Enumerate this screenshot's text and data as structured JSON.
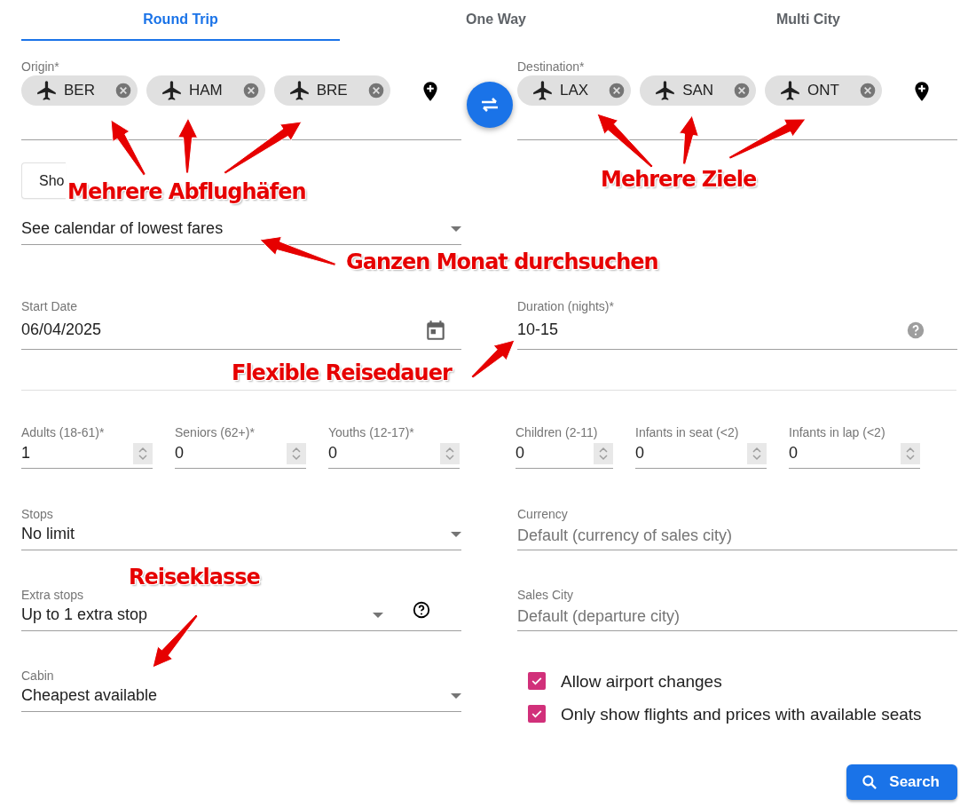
{
  "tabs": [
    {
      "label": "Round Trip",
      "selected": true
    },
    {
      "label": "One Way",
      "selected": false
    },
    {
      "label": "Multi City",
      "selected": false
    }
  ],
  "origin": {
    "label": "Origin*",
    "chips": [
      {
        "code": "BER"
      },
      {
        "code": "HAM"
      },
      {
        "code": "BRE"
      }
    ]
  },
  "destination": {
    "label": "Destination*",
    "chips": [
      {
        "code": "LAX"
      },
      {
        "code": "SAN"
      },
      {
        "code": "ONT"
      }
    ]
  },
  "advanced_button": {
    "label": "Sho"
  },
  "calendar_select": {
    "value": "See calendar of lowest fares"
  },
  "start_date": {
    "label": "Start Date",
    "value": "06/04/2025"
  },
  "duration": {
    "label": "Duration (nights)*",
    "value": "10-15"
  },
  "passengers": [
    {
      "label": "Adults (18-61)*",
      "value": "1"
    },
    {
      "label": "Seniors (62+)*",
      "value": "0"
    },
    {
      "label": "Youths (12-17)*",
      "value": "0"
    },
    {
      "label": "Children (2-11)",
      "value": "0"
    },
    {
      "label": "Infants in seat (<2)",
      "value": "0"
    },
    {
      "label": "Infants in lap (<2)",
      "value": "0"
    }
  ],
  "stops": {
    "label": "Stops",
    "value": "No limit"
  },
  "currency": {
    "label": "Currency",
    "placeholder": "Default (currency of sales city)"
  },
  "extra_stops": {
    "label": "Extra stops",
    "value": "Up to 1 extra stop"
  },
  "sales_city": {
    "label": "Sales City",
    "placeholder": "Default (departure city)"
  },
  "cabin": {
    "label": "Cabin",
    "value": "Cheapest available"
  },
  "checkboxes": [
    {
      "label": "Allow airport changes",
      "checked": true
    },
    {
      "label": "Only show flights and prices with available seats",
      "checked": true
    }
  ],
  "search_button": {
    "label": "Search"
  },
  "annotations": [
    {
      "text": "Mehrere Abflughäfen"
    },
    {
      "text": "Mehrere Ziele"
    },
    {
      "text": "Ganzen Monat durchsuchen"
    },
    {
      "text": "Flexible Reisedauer"
    },
    {
      "text": "Reiseklasse"
    }
  ]
}
